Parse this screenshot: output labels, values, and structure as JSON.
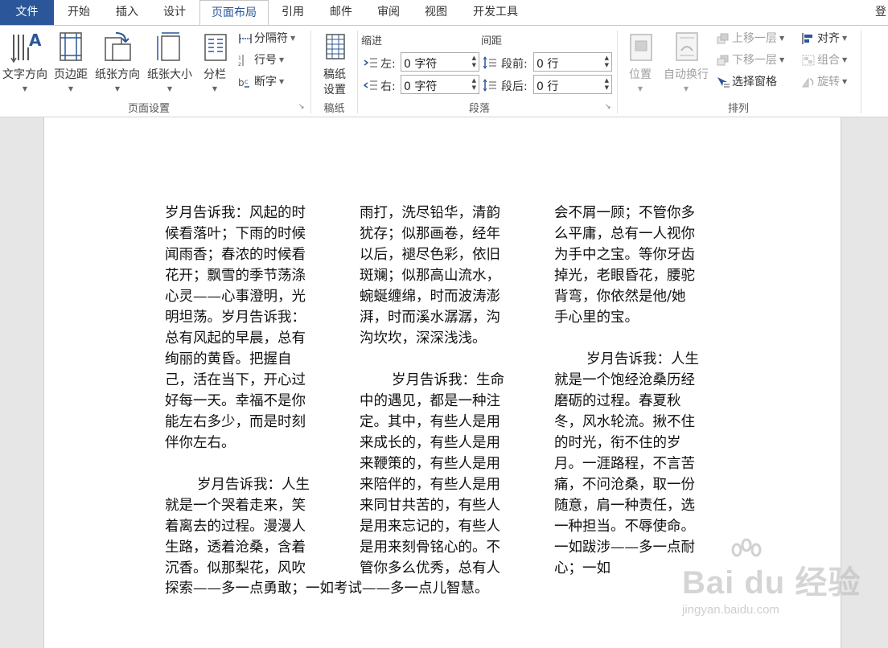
{
  "tabs": [
    "文件",
    "开始",
    "插入",
    "设计",
    "页面布局",
    "引用",
    "邮件",
    "审阅",
    "视图",
    "开发工具"
  ],
  "active_tab": "页面布局",
  "tab_clipped": "登",
  "page_setup": {
    "text_direction": "文字方向",
    "margins": "页边距",
    "orientation": "纸张方向",
    "size": "纸张大小",
    "columns": "分栏",
    "breaks": "分隔符",
    "line_numbers": "行号",
    "hyphenation": "断字",
    "group_label": "页面设置"
  },
  "draft_paper": {
    "button_line1": "稿纸",
    "button_line2": "设置",
    "group_label": "稿纸"
  },
  "paragraph": {
    "indent_header": "缩进",
    "spacing_header": "间距",
    "left_label": "左:",
    "left_value": "0 字符",
    "right_label": "右:",
    "right_value": "0 字符",
    "before_label": "段前:",
    "before_value": "0 行",
    "after_label": "段后:",
    "after_value": "0 行",
    "group_label": "段落"
  },
  "arrange": {
    "position": "位置",
    "wrap_text": "自动换行",
    "bring_forward": "上移一层",
    "send_backward": "下移一层",
    "selection_pane": "选择窗格",
    "align": "对齐",
    "group": "组合",
    "rotate": "旋转",
    "group_label": "排列"
  },
  "document": {
    "col1_para1": [
      "岁月告诉我：风起的时",
      "候看落叶；下雨的时候",
      "闻雨香；春浓的时候看",
      "花开；飘雪的季节荡涤",
      "心灵——心事澄明，光",
      "明坦荡。岁月告诉我：",
      "总有风起的早晨，总有",
      "绚丽的黄昏。把握自",
      "己，活在当下，开心过",
      "好每一天。幸福不是你",
      "能左右多少，而是时刻",
      "伴你左右。"
    ],
    "col1_para2": [
      "岁月告诉我：人生",
      "就是一个哭着走来，笑",
      "着离去的过程。漫漫人",
      "生路，透着沧桑，含着",
      "沉香。似那梨花，风吹"
    ],
    "col2_para1": [
      "雨打，洗尽铅华，清韵",
      "犹存；似那画卷，经年",
      "以后，褪尽色彩，依旧",
      "斑斓；似那高山流水，",
      "蜿蜒缠绵，时而波涛澎",
      "湃，时而溪水潺潺，沟",
      "沟坎坎，深深浅浅。"
    ],
    "col2_para2": [
      "岁月告诉我：生命",
      "中的遇见，都是一种注",
      "定。其中，有些人是用",
      "来成长的，有些人是用",
      "来鞭策的，有些人是用",
      "来陪伴的，有些人是用",
      "来同甘共苦的，有些人",
      "是用来忘记的，有些人",
      "是用来刻骨铭心的。不",
      "管你多么优秀，总有人"
    ],
    "col3_para1": [
      "会不屑一顾；不管你多",
      "么平庸，总有一人视你",
      "为手中之宝。等你牙齿",
      "掉光，老眼昏花，腰驼",
      "背弯，你依然是他/她",
      "手心里的宝。"
    ],
    "col3_para2": [
      "岁月告诉我：人生",
      "就是一个饱经沧桑历经",
      "磨砺的过程。春夏秋",
      "冬，风水轮流。揪不住",
      "的时光，衔不住的岁",
      "月。一涯路程，不言苦",
      "痛，不问沧桑，取一份",
      "随意，肩一种责任，选",
      "一种担当。不辱使命。",
      "一如跋涉——多一点耐",
      "心；一如"
    ],
    "last_line": "探索——多一点勇敢；一如考试——多一点儿智慧。"
  },
  "watermark": {
    "main": "Bai du 经验",
    "url": "jingyan.baidu.com"
  },
  "colors": {
    "file_tab": "#2b579a",
    "active_tab_text": "#2b579a"
  }
}
